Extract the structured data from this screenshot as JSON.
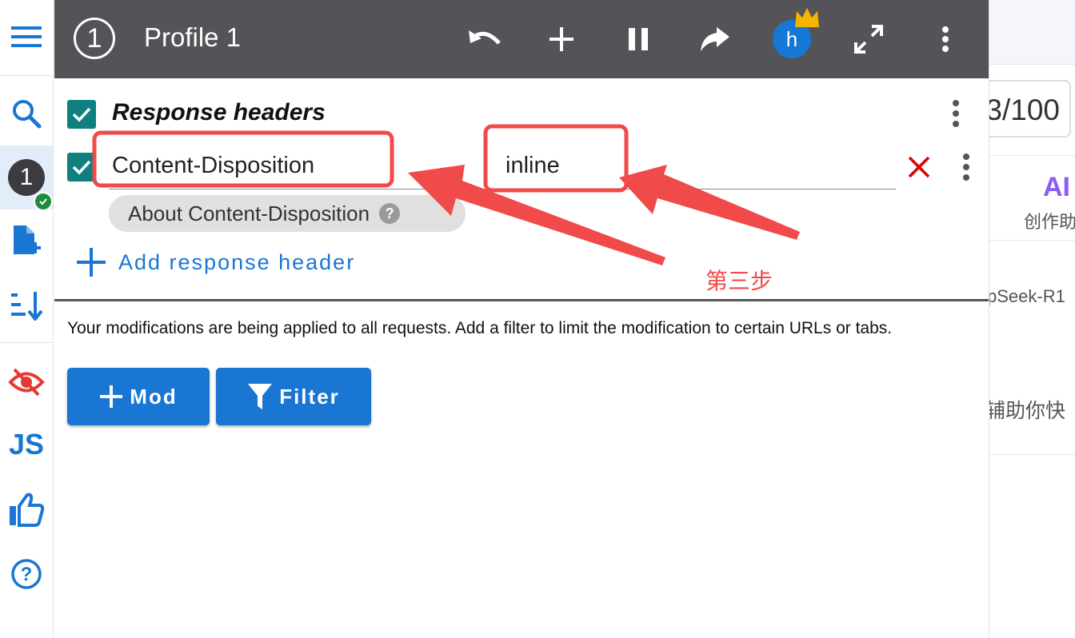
{
  "header": {
    "profile_number": "1",
    "profile_title": "Profile 1",
    "avatar_letter": "h"
  },
  "sidebar": {
    "profile_badge": "1",
    "js_label": "JS"
  },
  "section": {
    "title": "Response headers",
    "header_name": "Content-Disposition",
    "header_value": "inline",
    "about_chip": "About Content-Disposition",
    "help_glyph": "?",
    "add_label": "Add response header"
  },
  "notice": "Your modifications are being applied to all requests. Add a filter to limit the modification to certain URLs or tabs.",
  "buttons": {
    "mod_label": "Mod",
    "filter_label": "Filter"
  },
  "annotation": {
    "step_label": "第三步"
  },
  "background_page": {
    "counter_text": "3/100",
    "ai_logo": "AI",
    "create_text": "创作助",
    "model_text": "pSeek-R1",
    "assist_text": "辅助你快"
  },
  "colors": {
    "header_bg": "#545458",
    "accent_blue": "#1976d2",
    "checkbox_teal": "#0f7f7f",
    "annotation_red": "#f04a4a"
  }
}
